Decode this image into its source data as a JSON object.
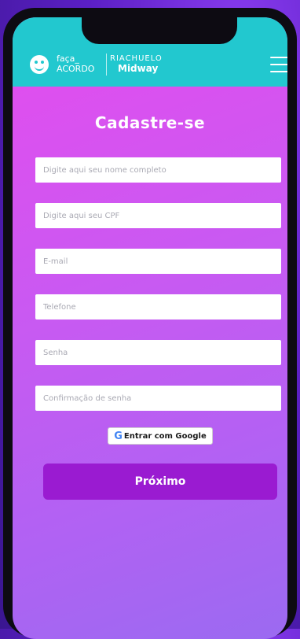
{
  "header": {
    "brand_line1": "faça_",
    "brand_line2": "ACORDO",
    "partner_line1": "RIACHUELO",
    "partner_line2": "Midway",
    "brand_color": "#22c8cf"
  },
  "form": {
    "title": "Cadastre-se",
    "fields": [
      {
        "placeholder": "Digite aqui seu nome completo",
        "value": ""
      },
      {
        "placeholder": "Digite aqui seu CPF",
        "value": ""
      },
      {
        "placeholder": "E-mail",
        "value": ""
      },
      {
        "placeholder": "Telefone",
        "value": ""
      },
      {
        "placeholder": "Senha",
        "value": ""
      },
      {
        "placeholder": "Confirmação de senha",
        "value": ""
      }
    ],
    "google_icon": "google-g-icon",
    "google_label": "Entrar com Google",
    "next_label": "Próximo",
    "next_color": "#9a1bd1"
  }
}
